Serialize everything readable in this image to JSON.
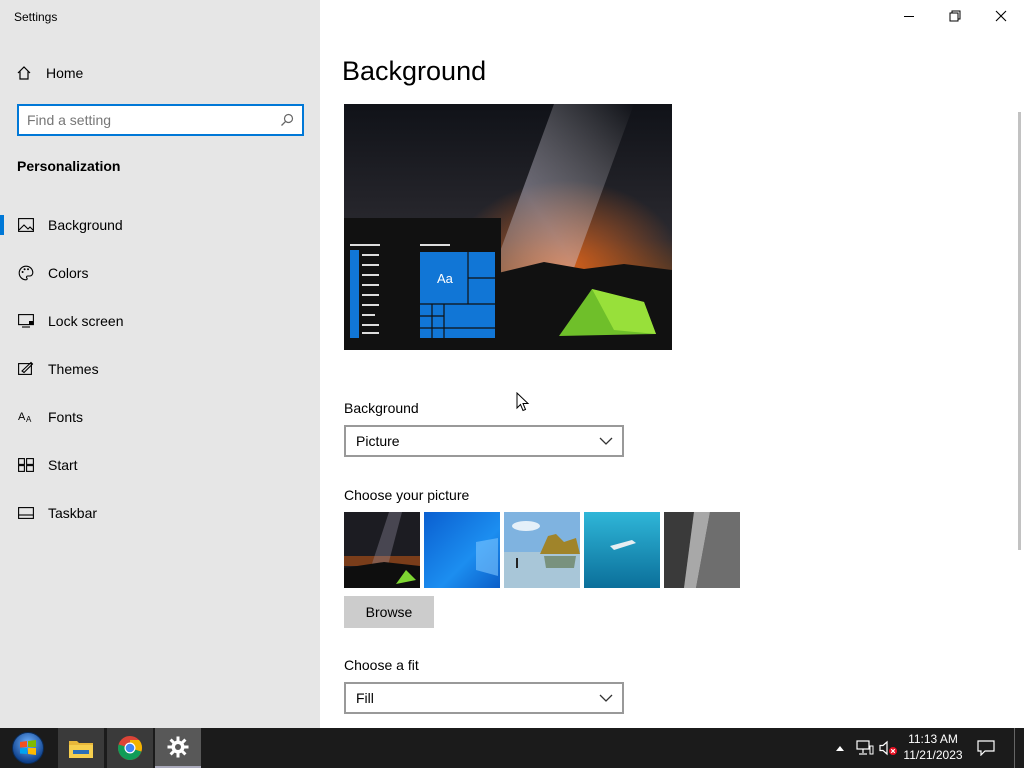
{
  "window": {
    "title": "Settings",
    "controls": {
      "minimize": "minimize-icon",
      "restore": "restore-icon",
      "close": "close-icon"
    }
  },
  "sidebar": {
    "home_label": "Home",
    "search_placeholder": "Find a setting",
    "section_title": "Personalization",
    "items": [
      {
        "label": "Background",
        "icon": "background-icon",
        "active": true
      },
      {
        "label": "Colors",
        "icon": "colors-palette-icon"
      },
      {
        "label": "Lock screen",
        "icon": "lock-screen-icon"
      },
      {
        "label": "Themes",
        "icon": "themes-icon"
      },
      {
        "label": "Fonts",
        "icon": "fonts-icon"
      },
      {
        "label": "Start",
        "icon": "start-icon"
      },
      {
        "label": "Taskbar",
        "icon": "taskbar-icon"
      }
    ]
  },
  "main": {
    "title": "Background",
    "preview": {
      "tile_text": "Aa"
    },
    "background_label": "Background",
    "background_value": "Picture",
    "choose_picture_label": "Choose your picture",
    "browse_label": "Browse",
    "fit_label": "Choose a fit",
    "fit_value": "Fill",
    "pictures": [
      "night-sky-tent",
      "windows-blue",
      "beach-rocks",
      "underwater-swimmer",
      "rock-cliff"
    ]
  },
  "taskbar": {
    "apps": [
      "start-orb-icon",
      "file-explorer-icon",
      "chrome-icon",
      "settings-gear-icon"
    ],
    "clock_time": "11:13 AM",
    "clock_date": "11/21/2023"
  },
  "colors": {
    "accent": "#0078d7",
    "sidebar_bg": "#e6e6e6",
    "taskbar_bg": "#1b1b1b"
  }
}
